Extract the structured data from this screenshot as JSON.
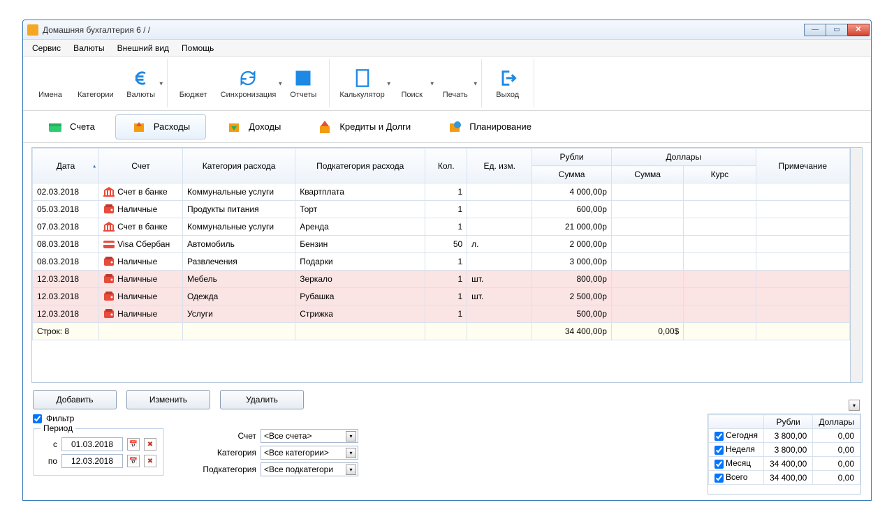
{
  "title": "Домашняя бухгалтерия 6  /                  /",
  "menu": [
    "Сервис",
    "Валюты",
    "Внешний вид",
    "Помощь"
  ],
  "toolbar": [
    {
      "label": "Имена",
      "icon": "people",
      "drop": false
    },
    {
      "label": "Категории",
      "icon": "tree",
      "drop": false
    },
    {
      "label": "Валюты",
      "icon": "euro",
      "drop": true
    },
    {
      "label": "Бюджет",
      "icon": "gauge",
      "drop": false,
      "sep": true
    },
    {
      "label": "Синхронизация",
      "icon": "sync",
      "drop": true
    },
    {
      "label": "Отчеты",
      "icon": "chart",
      "drop": false
    },
    {
      "label": "Калькулятор",
      "icon": "calc",
      "drop": true,
      "sep": true
    },
    {
      "label": "Поиск",
      "icon": "search",
      "drop": true
    },
    {
      "label": "Печать",
      "icon": "print",
      "drop": true
    },
    {
      "label": "Выход",
      "icon": "exit",
      "drop": false,
      "sep": true
    }
  ],
  "navtabs": [
    {
      "label": "Счета",
      "active": false
    },
    {
      "label": "Расходы",
      "active": true
    },
    {
      "label": "Доходы",
      "active": false
    },
    {
      "label": "Кредиты и Долги",
      "active": false
    },
    {
      "label": "Планирование",
      "active": false
    }
  ],
  "headers": {
    "date": "Дата",
    "account": "Счет",
    "category": "Категория расхода",
    "subcat": "Подкатегория расхода",
    "qty": "Кол.",
    "unit": "Ед. изм.",
    "rubles": "Рубли",
    "dollars": "Доллары",
    "sum": "Сумма",
    "rate": "Курс",
    "note": "Примечание"
  },
  "rows": [
    {
      "date": "02.03.2018",
      "acct": "Счет в банке",
      "icon": "bank",
      "cat": "Коммунальные услуги",
      "sub": "Квартплата",
      "qty": "1",
      "unit": "",
      "rub": "4 000,00р",
      "sel": false
    },
    {
      "date": "05.03.2018",
      "acct": "Наличные",
      "icon": "wallet",
      "cat": "Продукты питания",
      "sub": "Торт",
      "qty": "1",
      "unit": "",
      "rub": "600,00р",
      "sel": false
    },
    {
      "date": "07.03.2018",
      "acct": "Счет в банке",
      "icon": "bank",
      "cat": "Коммунальные услуги",
      "sub": "Аренда",
      "qty": "1",
      "unit": "",
      "rub": "21 000,00р",
      "sel": false
    },
    {
      "date": "08.03.2018",
      "acct": "Visa Сбербан",
      "icon": "card",
      "cat": "Автомобиль",
      "sub": "Бензин",
      "qty": "50",
      "unit": "л.",
      "rub": "2 000,00р",
      "sel": false
    },
    {
      "date": "08.03.2018",
      "acct": "Наличные",
      "icon": "wallet",
      "cat": "Развлечения",
      "sub": "Подарки",
      "qty": "1",
      "unit": "",
      "rub": "3 000,00р",
      "sel": false
    },
    {
      "date": "12.03.2018",
      "acct": "Наличные",
      "icon": "wallet",
      "cat": "Мебель",
      "sub": "Зеркало",
      "qty": "1",
      "unit": "шт.",
      "rub": "800,00р",
      "sel": true
    },
    {
      "date": "12.03.2018",
      "acct": "Наличные",
      "icon": "wallet",
      "cat": "Одежда",
      "sub": "Рубашка",
      "qty": "1",
      "unit": "шт.",
      "rub": "2 500,00р",
      "sel": true
    },
    {
      "date": "12.03.2018",
      "acct": "Наличные",
      "icon": "wallet",
      "cat": "Услуги",
      "sub": "Стрижка",
      "qty": "1",
      "unit": "",
      "rub": "500,00р",
      "sel": true
    }
  ],
  "summary": {
    "rows": "Строк: 8",
    "rub": "34 400,00р",
    "usd": "0,00$"
  },
  "buttons": {
    "add": "Добавить",
    "edit": "Изменить",
    "del": "Удалить"
  },
  "filter": {
    "check": "Фильтр",
    "period": "Период",
    "from_lbl": "с",
    "to_lbl": "по",
    "from": "01.03.2018",
    "to": "12.03.2018",
    "acct_lbl": "Счет",
    "acct_val": "<Все счета>",
    "cat_lbl": "Категория",
    "cat_val": "<Все категории>",
    "sub_lbl": "Подкатегория",
    "sub_val": "<Все подкатегори"
  },
  "totals": {
    "h_rub": "Рубли",
    "h_usd": "Доллары",
    "rows": [
      {
        "name": "Сегодня",
        "rub": "3 800,00",
        "usd": "0,00"
      },
      {
        "name": "Неделя",
        "rub": "3 800,00",
        "usd": "0,00"
      },
      {
        "name": "Месяц",
        "rub": "34 400,00",
        "usd": "0,00"
      },
      {
        "name": "Всего",
        "rub": "34 400,00",
        "usd": "0,00"
      }
    ]
  }
}
